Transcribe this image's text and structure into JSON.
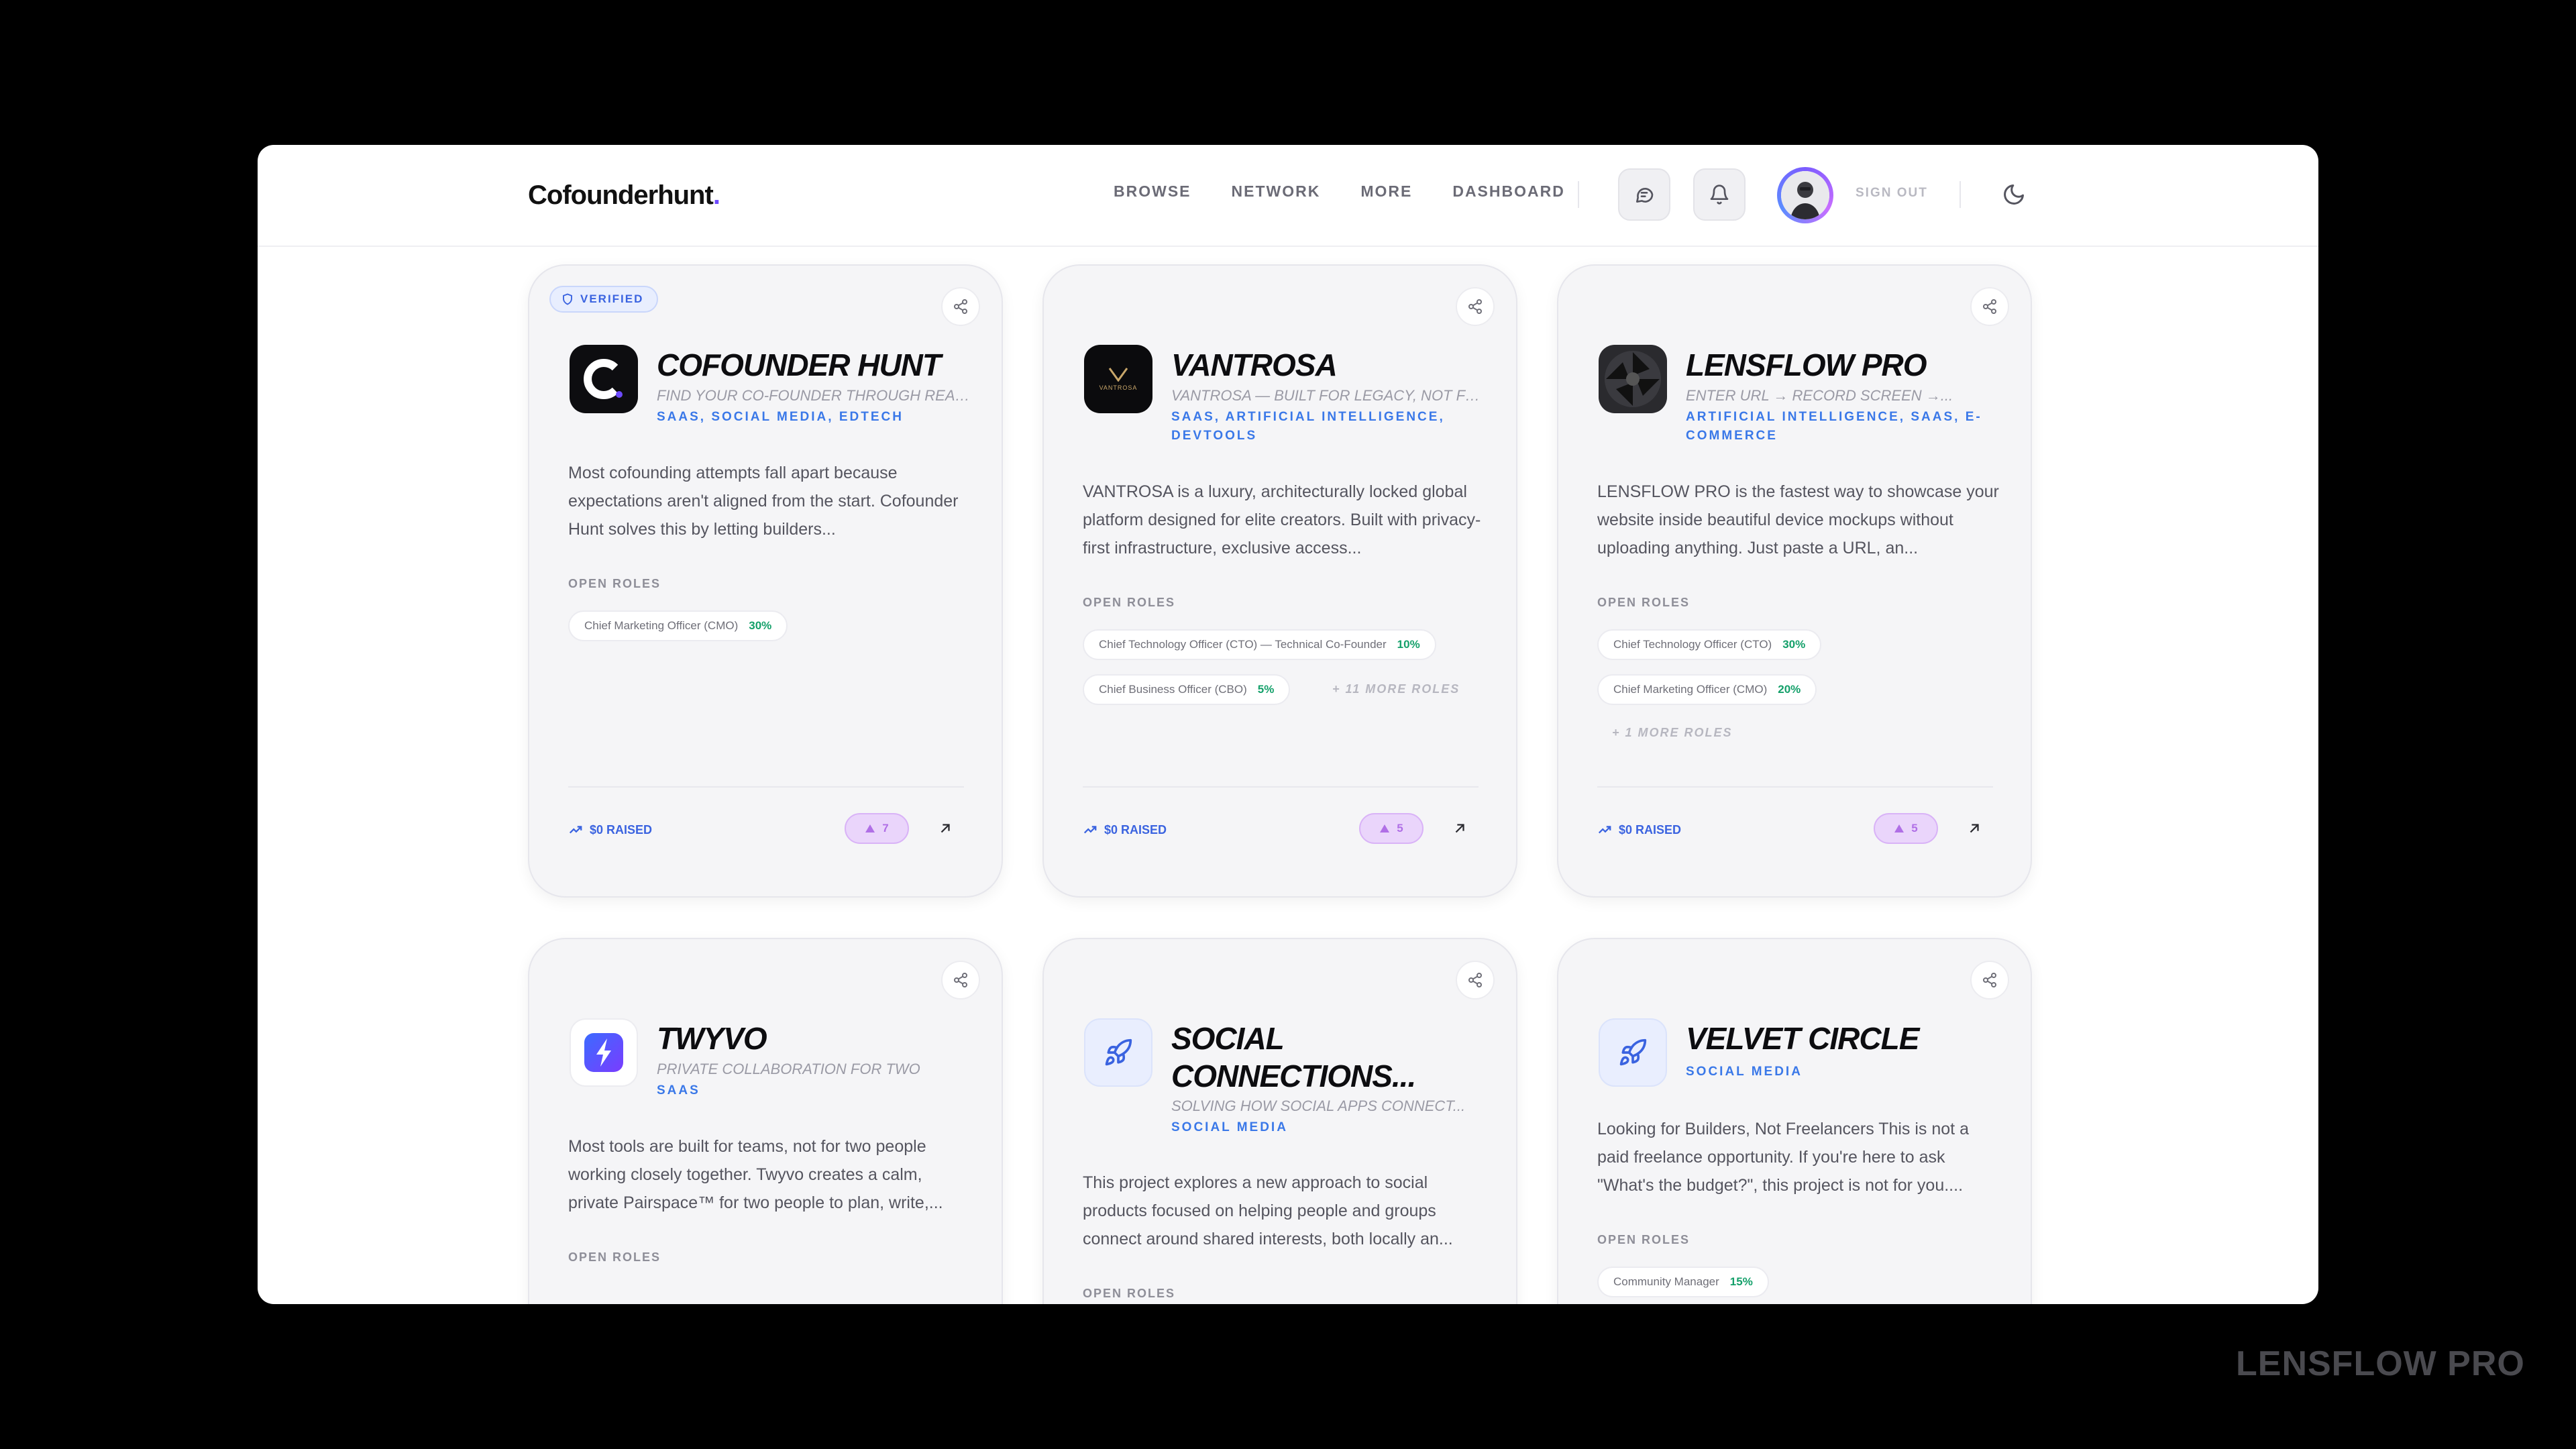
{
  "app": {
    "logo_text": "Cofounderhunt",
    "logo_dot": "."
  },
  "nav": {
    "links": [
      "BROWSE",
      "NETWORK",
      "MORE",
      "DASHBOARD"
    ],
    "sign_out": "SIGN OUT"
  },
  "icons": {
    "messages": "chat-bubble-icon",
    "notifications": "bell-icon",
    "theme": "moon-icon",
    "share": "share-icon",
    "verified": "shield-icon",
    "raised": "trending-up-icon",
    "upvote": "triangle-up-icon",
    "open": "arrow-up-right-icon"
  },
  "colors": {
    "accent": "#3a63e0",
    "tag_blue": "#3a78e8",
    "equity_green": "#14a06a",
    "upvote_purple": "#b06fe6",
    "background": "#000000"
  },
  "cards": [
    {
      "verified": "VERIFIED",
      "title": "COFOUNDER HUNT",
      "tagline": "FIND YOUR CO-FOUNDER THROUGH REAL...",
      "tags": "SAAS, SOCIAL MEDIA, EDTECH",
      "description": "Most cofounding attempts fall apart because expectations aren't aligned from the start. Cofounder Hunt solves this by letting builders...",
      "open_roles_label": "OPEN ROLES",
      "roles": [
        {
          "role": "Chief Marketing Officer (CMO)",
          "equity": "30%"
        }
      ],
      "raised": "$0 RAISED",
      "upvotes": "7"
    },
    {
      "title": "VANTROSA",
      "tagline": "VANTROSA — BUILT FOR LEGACY, NOT FOR...",
      "tags": "SAAS, ARTIFICIAL INTELLIGENCE, DEVTOOLS",
      "logo_text": "VANTROSA",
      "description": "VANTROSA is a luxury, architecturally locked global platform designed for elite creators. Built with privacy-first infrastructure, exclusive access...",
      "open_roles_label": "OPEN ROLES",
      "roles": [
        {
          "role": "Chief Technology Officer (CTO) — Technical Co-Founder",
          "equity": "10%"
        },
        {
          "role": "Chief Business Officer (CBO)",
          "equity": "5%"
        }
      ],
      "more_roles": "+ 11 MORE ROLES",
      "raised": "$0 RAISED",
      "upvotes": "5"
    },
    {
      "title": "LENSFLOW PRO",
      "tagline": "ENTER URL → RECORD SCREEN →...",
      "tags": "ARTIFICIAL INTELLIGENCE, SAAS, E-COMMERCE",
      "description": "LENSFLOW PRO is the fastest way to showcase your website inside beautiful device mockups without uploading anything. Just paste a URL, an...",
      "open_roles_label": "OPEN ROLES",
      "roles": [
        {
          "role": "Chief Technology Officer (CTO)",
          "equity": "30%"
        },
        {
          "role": "Chief Marketing Officer (CMO)",
          "equity": "20%"
        }
      ],
      "more_roles": "+ 1 MORE ROLES",
      "raised": "$0 RAISED",
      "upvotes": "5"
    },
    {
      "title": "TWYVO",
      "tagline": "PRIVATE COLLABORATION FOR TWO",
      "tags": "SAAS",
      "description": "Most tools are built for teams, not for two people working closely together. Twyvo creates a calm, private Pairspace™ for two people to plan, write,...",
      "open_roles_label": "OPEN ROLES"
    },
    {
      "title": "SOCIAL CONNECTIONS...",
      "tagline": "SOLVING HOW SOCIAL APPS CONNECT...",
      "tags": "SOCIAL MEDIA",
      "description": "This project explores a new approach to social products focused on helping people and groups connect around shared interests, both locally an...",
      "open_roles_label": "OPEN ROLES"
    },
    {
      "title": "VELVET CIRCLE",
      "tags": "SOCIAL MEDIA",
      "description": "Looking for Builders, Not Freelancers This is not a paid freelance opportunity. If you're here to ask \"What's the budget?\", this project is not for you....",
      "open_roles_label": "OPEN ROLES",
      "roles": [
        {
          "role": "Community Manager",
          "equity": "15%"
        }
      ]
    }
  ],
  "watermark": "LENSFLOW PRO"
}
